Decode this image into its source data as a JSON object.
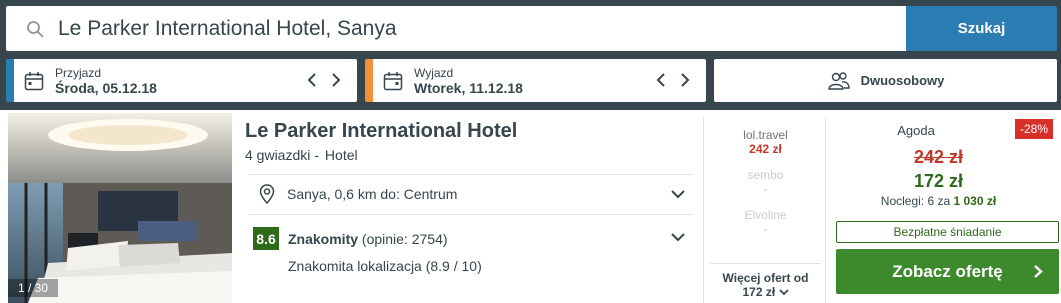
{
  "search": {
    "value": "Le Parker International Hotel, Sanya",
    "button_label": "Szukaj"
  },
  "dates": {
    "checkin": {
      "label": "Przyjazd",
      "value": "Środa, 05.12.18"
    },
    "checkout": {
      "label": "Wyjazd",
      "value": "Wtorek, 11.12.18"
    }
  },
  "room": {
    "label": "Dwuosobowy"
  },
  "hotel": {
    "photo_counter": "1 / 30",
    "name": "Le Parker International Hotel",
    "stars": "4 gwiazdki -",
    "type": "Hotel",
    "location": "Sanya, 0,6 km do: Centrum",
    "rating_score": "8.6",
    "rating_label": "Znakomity",
    "rating_reviews": "(opinie: 2754)",
    "rating_detail": "Znakomita lokalizacja (8.9 / 10)"
  },
  "partners": [
    {
      "name": "lol.travel",
      "price": "242 zł"
    },
    {
      "name": "sembo",
      "price": "-"
    },
    {
      "name": "Elvoline",
      "price": "-"
    }
  ],
  "more_offers": {
    "label": "Więcej ofert od",
    "price": "172 zł"
  },
  "deal": {
    "provider": "Agoda",
    "discount": "-28%",
    "old_price": "242 zł",
    "new_price": "172 zł",
    "nights_label": "Noclegi: 6 za",
    "nights_total": "1 030 zł",
    "breakfast": "Bezpłatne śniadanie",
    "cta": "Zobacz ofertę"
  },
  "colors": {
    "background": "#37454d",
    "primary_blue": "#2b7cb3",
    "checkout_orange": "#f48f3a",
    "rating_green": "#2d6a19",
    "cta_green": "#3c8a2b",
    "price_red": "#c0392b",
    "discount_red": "#d8302b"
  }
}
